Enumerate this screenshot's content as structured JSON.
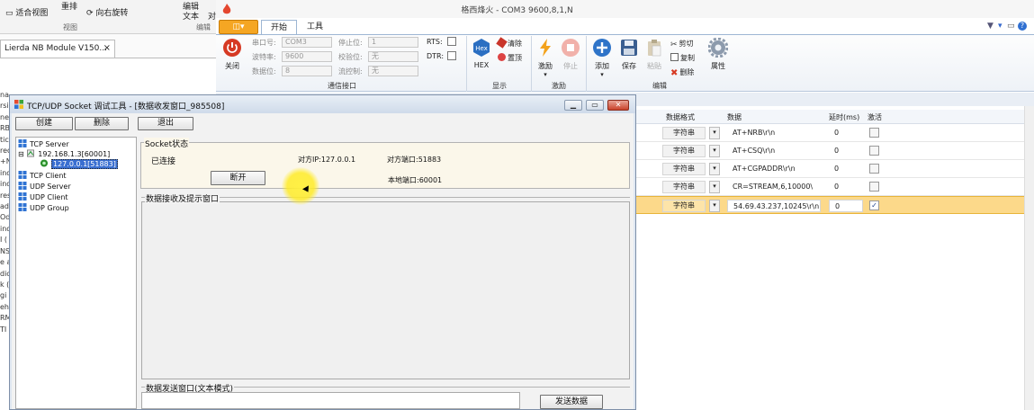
{
  "background_app": {
    "ribbon_items": {
      "fit_view": "适合视图",
      "rearrange": "重排",
      "rotate_right": "向右旋转",
      "edit": "编辑",
      "text": "文本",
      "text2": "对",
      "group_view": "视图",
      "group_edit": "编辑"
    },
    "doc_tab": "Lierda NB Module V150...",
    "doc_tab_close": "×",
    "margin_text": [
      "na",
      "rsi",
      "ner",
      "RB",
      "tics",
      "req",
      "+N",
      "ind",
      "ind",
      "ress",
      "ad(",
      "Od",
      "ind",
      "I (",
      "NS",
      "e a",
      "dic",
      "k (",
      "gi",
      "eh",
      "RM",
      "TI"
    ]
  },
  "serial_tool": {
    "title": "格西烽火 - COM3  9600,8,1,N",
    "app_button": "◫▾",
    "tabs": [
      "开始",
      "工具"
    ],
    "comm": {
      "close_label": "关闭",
      "port_label": "串口号:",
      "port_value": "COM3",
      "baud_label": "波特率:",
      "baud_value": "9600",
      "databits_label": "数据位:",
      "databits_value": "8",
      "stopbits_label": "停止位:",
      "stopbits_value": "1",
      "parity_label": "校验位:",
      "parity_value": "无",
      "flow_label": "流控制:",
      "flow_value": "无",
      "rts_label": "RTS:",
      "dtr_label": "DTR:",
      "group_label": "通信接口"
    },
    "display": {
      "hex_label": "HEX",
      "clear_label": "清除",
      "pin_label": "置顶",
      "group_label": "显示"
    },
    "stimulus": {
      "excite_label": "激励",
      "stop_label": "停止",
      "group_label": "激励"
    },
    "edit": {
      "add_label": "添加",
      "save_label": "保存",
      "paste_label": "粘贴",
      "cut_label": "剪切",
      "copy_label": "复制",
      "delete_label": "删除",
      "props_label": "属性",
      "group_label": "编辑"
    },
    "grid": {
      "headers": {
        "format": "数据格式",
        "data": "数据",
        "delay": "延时(ms)",
        "active": "激活"
      },
      "rows": [
        {
          "format": "字符串",
          "data": "AT+NRB\\r\\n",
          "delay": "0",
          "active": ""
        },
        {
          "format": "字符串",
          "data": "AT+CSQ\\r\\n",
          "delay": "0",
          "active": ""
        },
        {
          "format": "字符串",
          "data": "AT+CGPADDR\\r\\n",
          "delay": "0",
          "active": ""
        },
        {
          "format": "字符串",
          "data": "CR=STREAM,6,10000\\",
          "delay": "0",
          "active": ""
        },
        {
          "format": "字符串",
          "data": "54.69.43.237,10245\\r\\n",
          "delay": "0",
          "active": "✓"
        }
      ],
      "dropdown_glyph": "▾"
    }
  },
  "socket_window": {
    "title": "TCP/UDP Socket 调试工具 - [数据收发窗口_985508]",
    "buttons": {
      "create": "创建",
      "delete": "删除",
      "exit": "退出"
    },
    "tree": {
      "tcp_server": "TCP Server",
      "server_node": "192.168.1.3[60001]",
      "client_node": "127.0.0.1[51883]",
      "tcp_client": "TCP Client",
      "udp_server": "UDP Server",
      "udp_client": "UDP Client",
      "udp_group": "UDP Group",
      "expander": "⊟"
    },
    "status": {
      "legend": "Socket状态",
      "connected": "已连接",
      "remote_ip": "对方IP:127.0.0.1",
      "remote_port": "对方端口:51883",
      "local_port": "本地端口:60001",
      "disconnect": "断开"
    },
    "recv_legend": "数据接收及提示窗口",
    "send_legend": "数据发送窗口(文本模式)",
    "send_button": "发送数据"
  },
  "colors": {
    "selected_row": "#fcd98a",
    "accent_orange": "#f5a623",
    "close_red": "#d63a24",
    "tree_select": "#3a6fd1"
  }
}
